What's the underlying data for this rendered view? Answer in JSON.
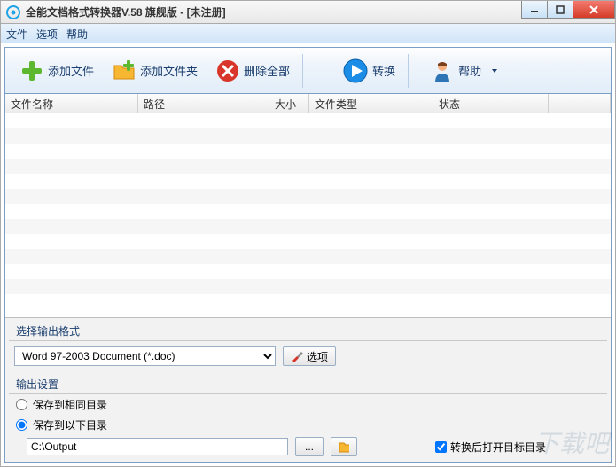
{
  "title": "全能文档格式转换器V.58 旗舰版     -      [未注册]",
  "menu": {
    "file": "文件",
    "options": "选项",
    "help": "帮助"
  },
  "toolbar": {
    "add_file": "添加文件",
    "add_folder": "添加文件夹",
    "delete_all": "删除全部",
    "convert": "转换",
    "help": "帮助"
  },
  "columns": {
    "name": "文件名称",
    "path": "路径",
    "size": "大小",
    "type": "文件类型",
    "status": "状态"
  },
  "format": {
    "label": "选择输出格式",
    "selected": "Word 97-2003 Document (*.doc)",
    "options_btn": "选项"
  },
  "output": {
    "label": "输出设置",
    "same_dir": "保存到相同目录",
    "below_dir": "保存到以下目录",
    "path": "C:\\Output",
    "open_after": "转换后打开目标目录",
    "selected_radio": "below",
    "open_after_checked": true
  },
  "watermark": "下载吧"
}
